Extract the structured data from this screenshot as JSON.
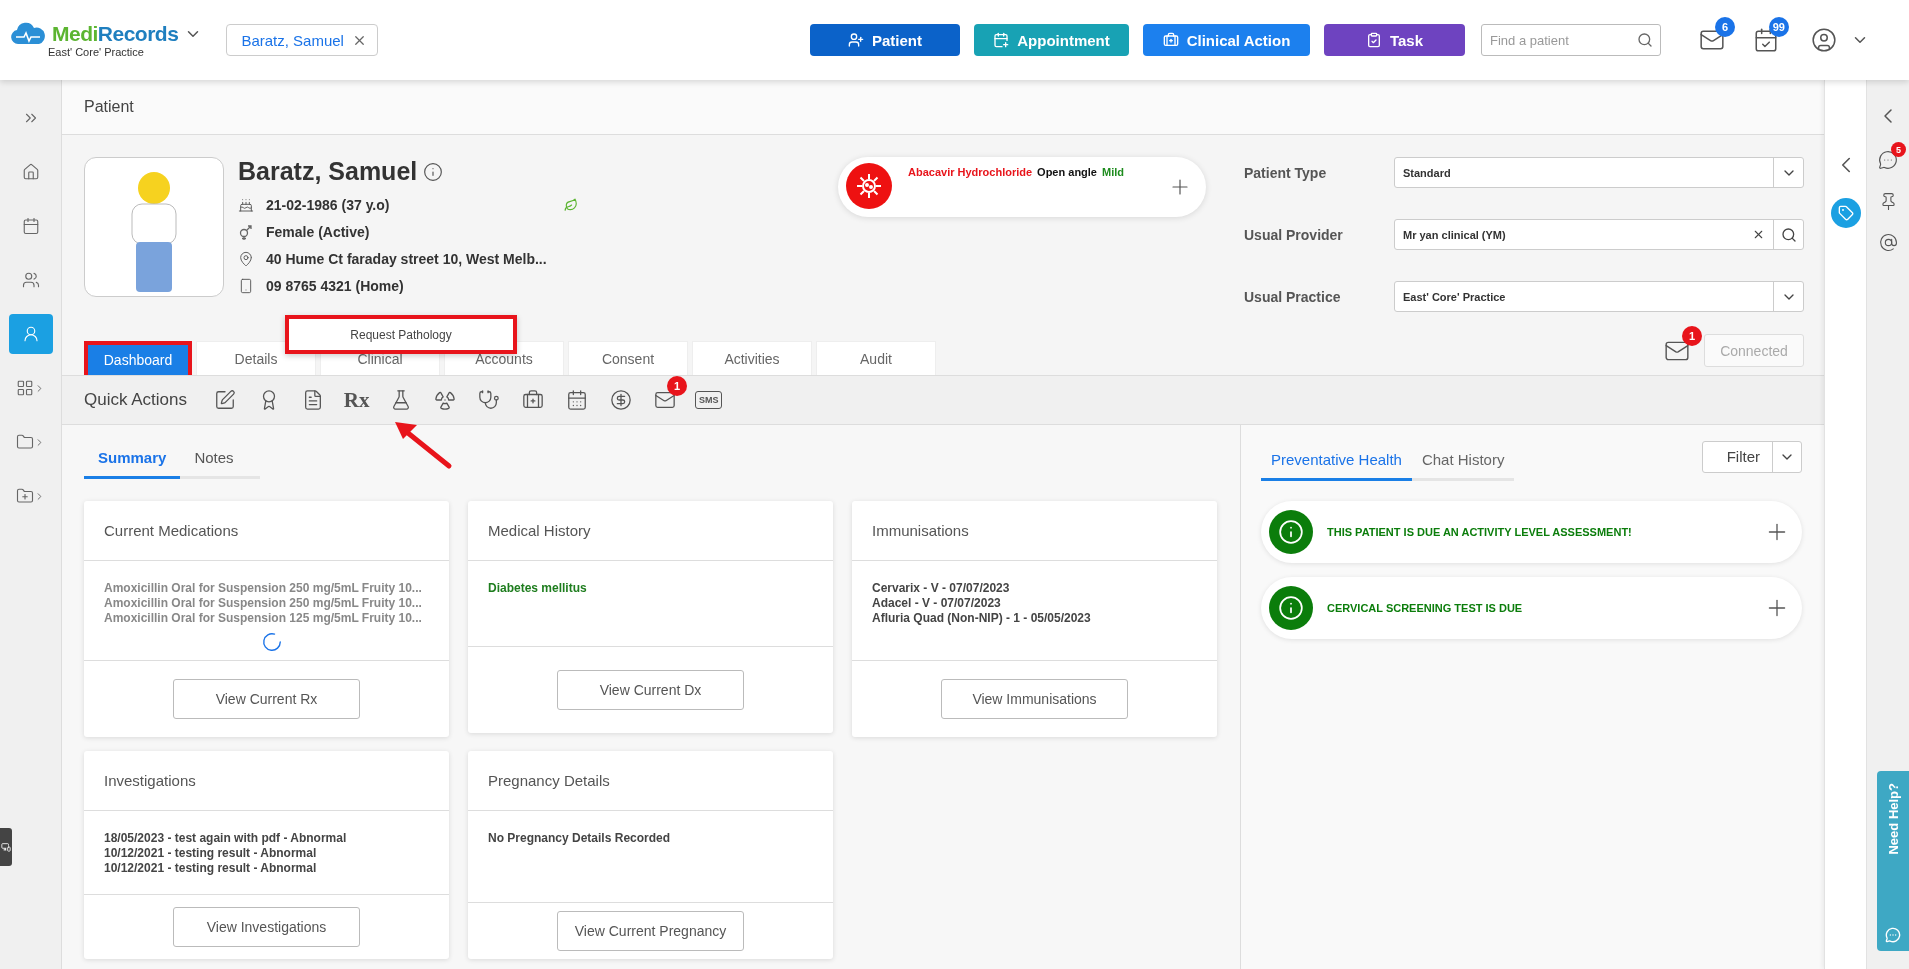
{
  "topbar": {
    "logo": [
      "Medi",
      "Records"
    ],
    "practice": "East' Core' Practice",
    "open_patient": "Baratz, Samuel",
    "actions": [
      {
        "label": "Patient",
        "color": "#0b62c9"
      },
      {
        "label": "Appointment",
        "color": "#18a2b4"
      },
      {
        "label": "Clinical Action",
        "color": "#1c80ee"
      },
      {
        "label": "Task",
        "color": "#6e43c0"
      }
    ],
    "search": {
      "placeholder": "Find a patient"
    },
    "mail_badge": "6",
    "tasks_badge": "99"
  },
  "nav": [
    {
      "selected": false,
      "expandable": false
    },
    {
      "selected": false,
      "expandable": false
    },
    {
      "selected": false,
      "expandable": false
    },
    {
      "selected": false,
      "expandable": false
    },
    {
      "selected": true,
      "expandable": false
    },
    {
      "selected": false,
      "expandable": true
    },
    {
      "selected": false,
      "expandable": true
    },
    {
      "selected": false,
      "expandable": true
    }
  ],
  "page_title": "Patient",
  "patient": {
    "name": "Baratz, Samuel",
    "dob": "21-02-1986 (37 y.o)",
    "gender": "Female (Active)",
    "address": "40 Hume Ct faraday street 10, West Melb...",
    "phone": "09 8765 4321 (Home)"
  },
  "alerts": [
    {
      "text": "Abacavir Hydrochloride",
      "color": "#e8141b"
    },
    {
      "text": "Open angle",
      "color": "#111111"
    },
    {
      "text": "Mild",
      "color": "#1e8c1e"
    }
  ],
  "fields": [
    {
      "label": "Patient Type",
      "value": "Standard",
      "kind": "select"
    },
    {
      "label": "Usual Provider",
      "value": "Mr yan clinical (YM)",
      "kind": "lookup"
    },
    {
      "label": "Usual Practice",
      "value": "East' Core' Practice",
      "kind": "select"
    }
  ],
  "messages_badge": "1",
  "connection": {
    "label": "Connected",
    "disabled": true
  },
  "tabs": [
    {
      "label": "Dashboard",
      "selected": true,
      "outlined": true
    },
    {
      "label": "Details",
      "selected": false,
      "outlined": false
    },
    {
      "label": "Clinical",
      "selected": false,
      "outlined": false
    },
    {
      "label": "Accounts",
      "selected": false,
      "outlined": false
    },
    {
      "label": "Consent",
      "selected": false,
      "outlined": false
    },
    {
      "label": "Activities",
      "selected": false,
      "outlined": false
    },
    {
      "label": "Audit",
      "selected": false,
      "outlined": false
    }
  ],
  "quick_actions": {
    "title": "Quick Actions",
    "items": [
      {
        "kind": "icon"
      },
      {
        "kind": "icon"
      },
      {
        "kind": "icon"
      },
      {
        "kind": "text",
        "label": "Rx"
      },
      {
        "kind": "icon",
        "tooltip": "Request Pathology",
        "pointed": true
      },
      {
        "kind": "icon"
      },
      {
        "kind": "icon"
      },
      {
        "kind": "icon"
      },
      {
        "kind": "icon"
      },
      {
        "kind": "icon"
      },
      {
        "kind": "icon",
        "badge": "1"
      },
      {
        "kind": "bubble",
        "label": "SMS"
      }
    ]
  },
  "subtabs": [
    {
      "label": "Summary",
      "selected": true
    },
    {
      "label": "Notes",
      "selected": false
    }
  ],
  "cards": [
    {
      "title": "Current Medications",
      "color": "#888888",
      "loading": true,
      "lines": [
        "Amoxicillin Oral for Suspension 250 mg/5mL Fruity 10...",
        "Amoxicillin Oral for Suspension 250 mg/5mL Fruity 10...",
        "Amoxicillin Oral for Suspension 125 mg/5mL Fruity 10..."
      ],
      "button": "View Current Rx"
    },
    {
      "title": "Medical History",
      "color": "#1e7d1e",
      "loading": false,
      "lines": [
        "Diabetes mellitus"
      ],
      "button": "View Current Dx"
    },
    {
      "title": "Immunisations",
      "color": "#444444",
      "loading": false,
      "lines": [
        "Cervarix - V - 07/07/2023",
        "Adacel - V - 07/07/2023",
        "Afluria Quad (Non-NIP) - 1 - 05/05/2023"
      ],
      "button": "View Immunisations"
    },
    {
      "title": "Investigations",
      "color": "#444444",
      "loading": false,
      "lines": [
        "18/05/2023 - test again with pdf - Abnormal",
        "10/12/2021 - testing result - Abnormal",
        "10/12/2021 - testing result - Abnormal"
      ],
      "button": "View Investigations"
    },
    {
      "title": "Pregnancy Details",
      "color": "#444444",
      "loading": false,
      "lines": [
        "No Pregnancy Details Recorded"
      ],
      "button": "View Current Pregnancy"
    }
  ],
  "preventative": {
    "tabs": [
      {
        "label": "Preventative Health",
        "selected": true
      },
      {
        "label": "Chat History",
        "selected": false
      }
    ],
    "filter": "Filter",
    "items": [
      "THIS PATIENT IS DUE AN ACTIVITY LEVEL ASSESSMENT!",
      "CERVICAL SCREENING TEST IS DUE"
    ]
  },
  "side": {
    "chat_badge": "5"
  },
  "help": "Need Help?"
}
